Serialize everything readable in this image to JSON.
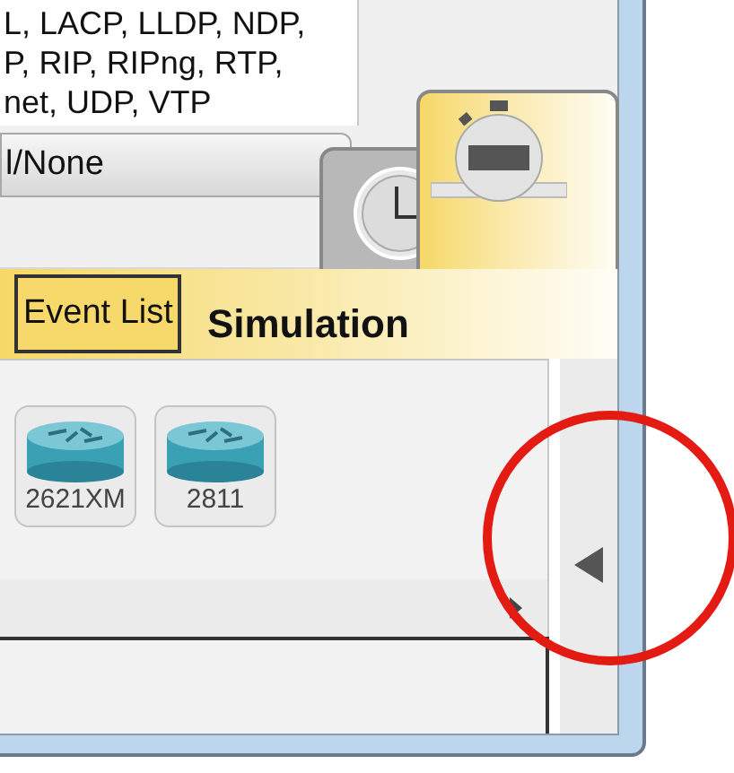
{
  "protocol_list": {
    "lines": [
      "L, LACP, LLDP, NDP,",
      "P, RIP, RIPng, RTP,",
      "net, UDP, VTP"
    ]
  },
  "filter_dropdown": {
    "value": "l/None"
  },
  "mode_tabs": [
    {
      "kind": "realtime",
      "selected": false
    },
    {
      "kind": "simulation",
      "selected": true
    }
  ],
  "event_list_button": {
    "label": "Event List"
  },
  "mode_label": "Simulation",
  "devices": [
    {
      "label": "2621XM"
    },
    {
      "label": "2811"
    }
  ]
}
